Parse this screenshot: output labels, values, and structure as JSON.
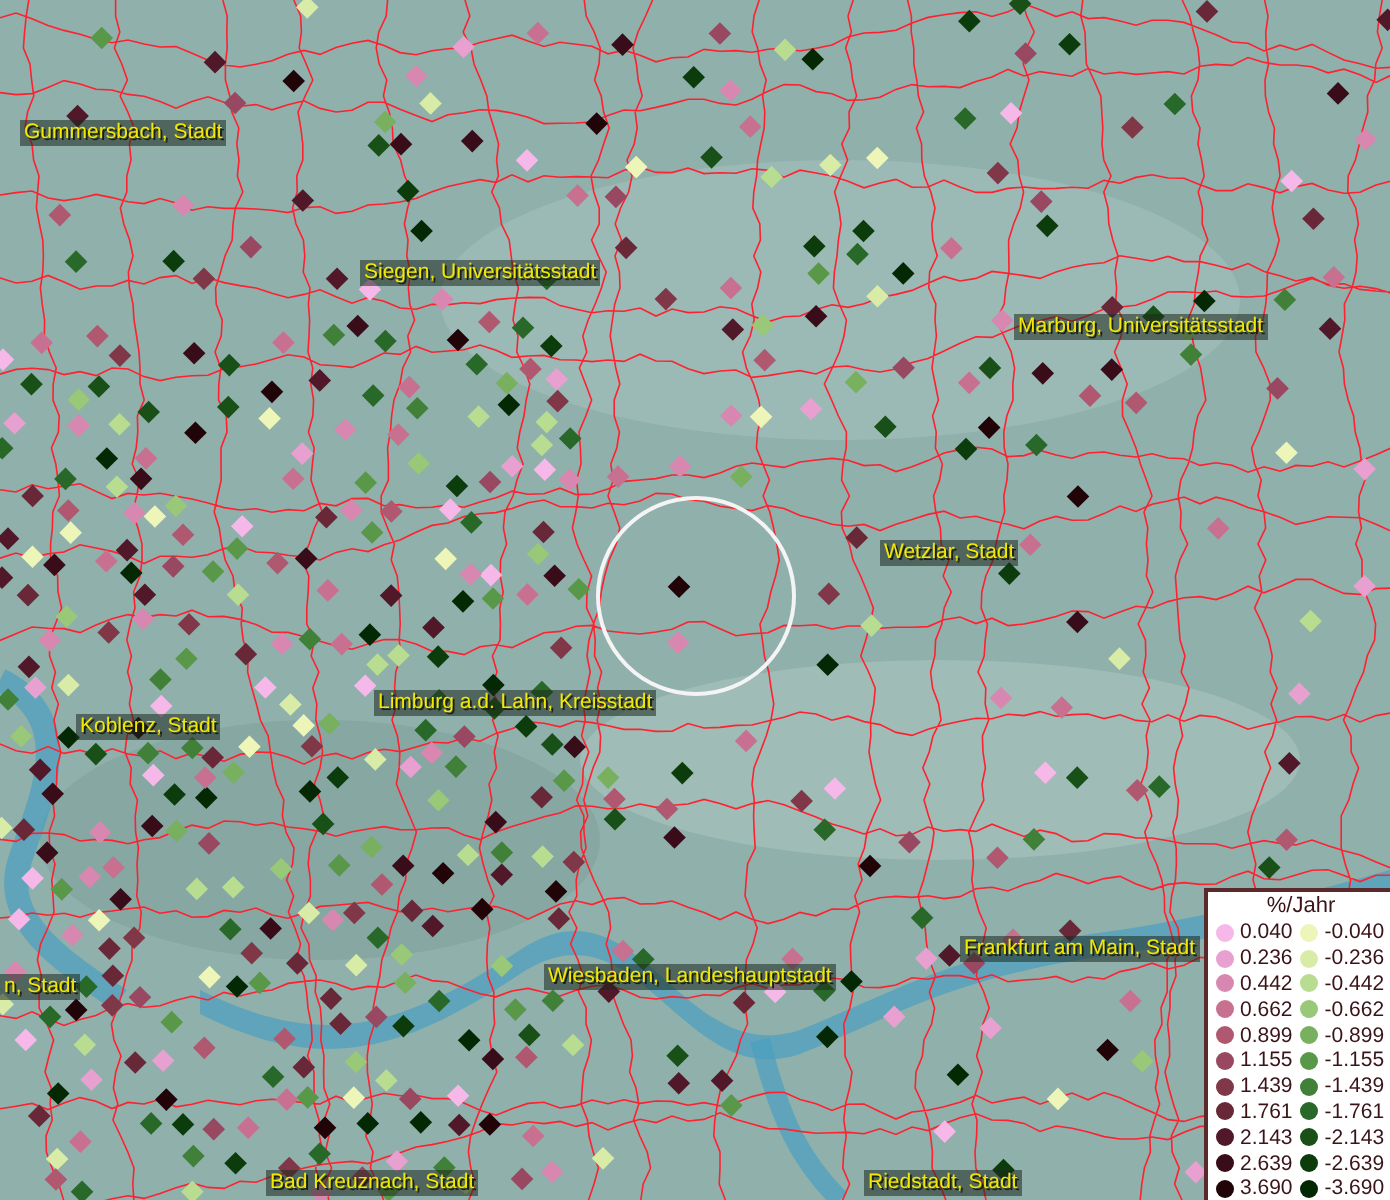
{
  "map": {
    "place_labels": [
      {
        "text": "Gummersbach, Stadt"
      },
      {
        "text": "Siegen, Universitätsstadt"
      },
      {
        "text": "Marburg, Universitätsstadt"
      },
      {
        "text": "Wetzlar, Stadt"
      },
      {
        "text": "Koblenz, Stadt"
      },
      {
        "text": "Limburg a.d. Lahn, Kreisstadt"
      },
      {
        "text": "n, Stadt"
      },
      {
        "text": "Frankfurt am Main, Stadt"
      },
      {
        "text": "Wiesbaden, Landeshauptstadt"
      },
      {
        "text": "Bad Kreuznach, Stadt"
      },
      {
        "text": "Riedstadt, Stadt"
      }
    ]
  },
  "legend": {
    "title": "%/Jahr",
    "columns": [
      {
        "entries": [
          {
            "label": "0.040",
            "color": "#f5b8e8"
          },
          {
            "label": "0.236",
            "color": "#e8a0d0"
          },
          {
            "label": "0.442",
            "color": "#d888b0"
          },
          {
            "label": "0.662",
            "color": "#c87090"
          },
          {
            "label": "0.899",
            "color": "#b05870"
          },
          {
            "label": "1.155",
            "color": "#984860"
          },
          {
            "label": "1.439",
            "color": "#803848"
          },
          {
            "label": "1.761",
            "color": "#682838"
          },
          {
            "label": "2.143",
            "color": "#501828"
          },
          {
            "label": "2.639",
            "color": "#380c18"
          },
          {
            "label": "3.690",
            "color": "#200408"
          }
        ]
      },
      {
        "entries": [
          {
            "label": "-0.040",
            "color": "#eef5b8"
          },
          {
            "label": "-0.236",
            "color": "#d8eca8"
          },
          {
            "label": "-0.442",
            "color": "#b8dc90"
          },
          {
            "label": "-0.662",
            "color": "#98c878"
          },
          {
            "label": "-0.899",
            "color": "#78b060"
          },
          {
            "label": "-1.155",
            "color": "#589848"
          },
          {
            "label": "-1.439",
            "color": "#408038"
          },
          {
            "label": "-1.761",
            "color": "#286828"
          },
          {
            "label": "-2.143",
            "color": "#185018"
          },
          {
            "label": "-2.639",
            "color": "#0c3c0c"
          },
          {
            "label": "-3.690",
            "color": "#042804"
          }
        ]
      }
    ]
  }
}
